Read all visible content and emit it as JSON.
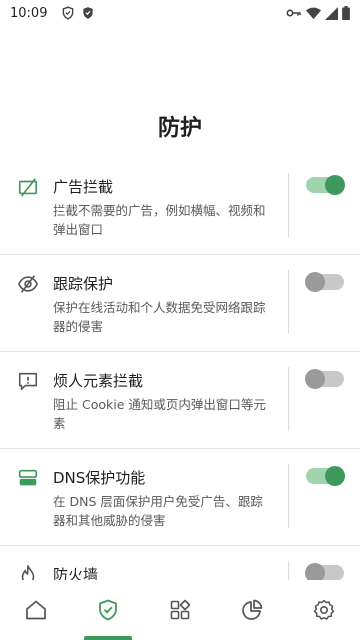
{
  "status_bar": {
    "time": "10:09"
  },
  "page_title": "防护",
  "protections": [
    {
      "title": "广告拦截",
      "desc": "拦截不需要的广告，例如横幅、视频和弹出窗口",
      "enabled": true,
      "icon": "ad-block-icon"
    },
    {
      "title": "跟踪保护",
      "desc": "保护在线活动和个人数据免受网络跟踪器的侵害",
      "enabled": false,
      "icon": "eye-off-icon"
    },
    {
      "title": "烦人元素拦截",
      "desc": "阻止 Cookie 通知或页内弹出窗口等元素",
      "enabled": false,
      "icon": "annoyance-icon"
    },
    {
      "title": "DNS保护功能",
      "desc": "在 DNS 层面保护用户免受广告、跟踪器和其他威胁的侵害",
      "enabled": true,
      "icon": "dns-server-icon"
    },
    {
      "title": "防火墙",
      "desc": "",
      "enabled": false,
      "icon": "flame-icon"
    }
  ],
  "bottom_nav": {
    "items": [
      "home-icon",
      "shield-check-icon",
      "apps-grid-icon",
      "stats-pie-icon",
      "settings-gear-icon"
    ],
    "active_index": 1
  },
  "colors": {
    "accent": "#3c9a5c",
    "toggle_on_track": "#9fd4ad",
    "toggle_off_track": "#c8c8c8",
    "toggle_off_knob": "#9a9a9a"
  }
}
